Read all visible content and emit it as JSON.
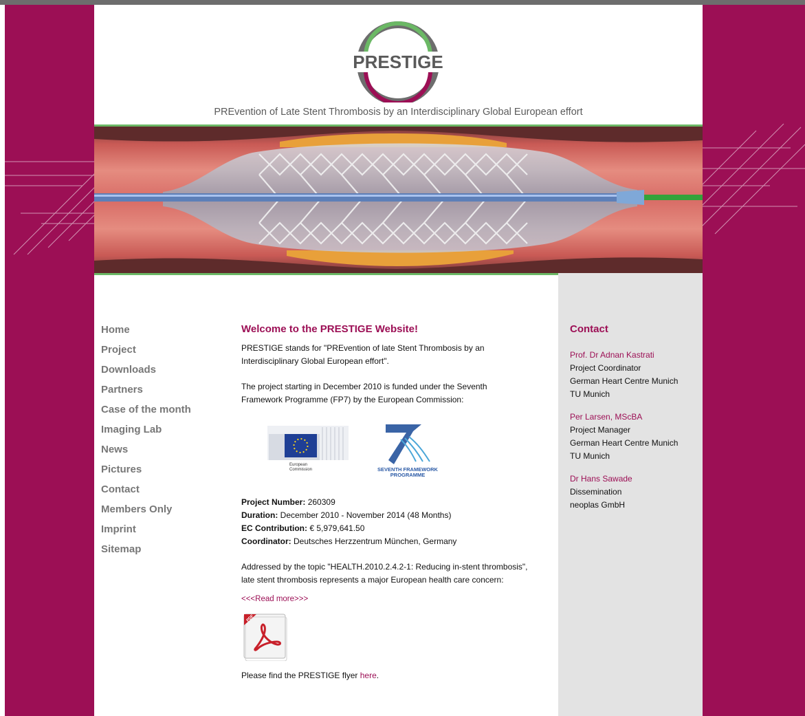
{
  "colors": {
    "brand": "#9c0f55",
    "accent_green": "#6bb865",
    "nav_text": "#777777",
    "contact_bg": "#e3e3e3"
  },
  "header": {
    "logo_text": "PRESTIGE",
    "tagline": "PREvention of Late Stent Thrombosis by an Interdisciplinary Global European effort"
  },
  "nav": {
    "items": [
      {
        "label": "Home"
      },
      {
        "label": "Project"
      },
      {
        "label": "Downloads"
      },
      {
        "label": "Partners"
      },
      {
        "label": "Case of the month"
      },
      {
        "label": "Imaging Lab"
      },
      {
        "label": "News"
      },
      {
        "label": "Pictures"
      },
      {
        "label": "Contact"
      },
      {
        "label": "Members Only"
      },
      {
        "label": "Imprint"
      },
      {
        "label": "Sitemap"
      }
    ]
  },
  "main": {
    "title": "Welcome to the PRESTIGE Website!",
    "intro": "PRESTIGE stands for \"PREvention of late Stent Thrombosis by an Interdisciplinary Global European effort\".",
    "funding": "The project starting in December 2010 is funded under the Seventh Framework Programme (FP7) by the European Commission:",
    "logos": {
      "ec_text_1": "European",
      "ec_text_2": "Commission",
      "fp7_text_1": "SEVENTH FRAMEWORK",
      "fp7_text_2": "PROGRAMME"
    },
    "facts": [
      {
        "label": "Project Number:",
        "value": " 260309"
      },
      {
        "label": "Duration:",
        "value": " December 2010 - November 2014 (48 Months)"
      },
      {
        "label": "EC Contribution:",
        "value": " € 5,979,641.50"
      },
      {
        "label": "Coordinator:",
        "value": " Deutsches Herzzentrum München, Germany"
      }
    ],
    "topic": "Addressed by the topic \"HEALTH.2010.2.4.2-1: Reducing in-stent thrombosis\", late stent thrombosis represents a major European health care concern:",
    "read_more": "<<<Read more>>>",
    "pdf_badge": "PDF",
    "flyer_prefix": "Please find the PRESTIGE flyer ",
    "flyer_link": "here",
    "flyer_suffix": "."
  },
  "contact": {
    "title": "Contact",
    "people": [
      {
        "name": "Prof. Dr Adnan Kastrati",
        "lines": [
          "Project Coordinator",
          "German Heart Centre Munich",
          "TU Munich"
        ]
      },
      {
        "name": "Per Larsen, MScBA",
        "lines": [
          "Project Manager",
          "German Heart Centre Munich",
          "TU Munich"
        ]
      },
      {
        "name": "Dr Hans Sawade",
        "lines": [
          "Dissemination",
          "neoplas GmbH"
        ]
      }
    ]
  }
}
